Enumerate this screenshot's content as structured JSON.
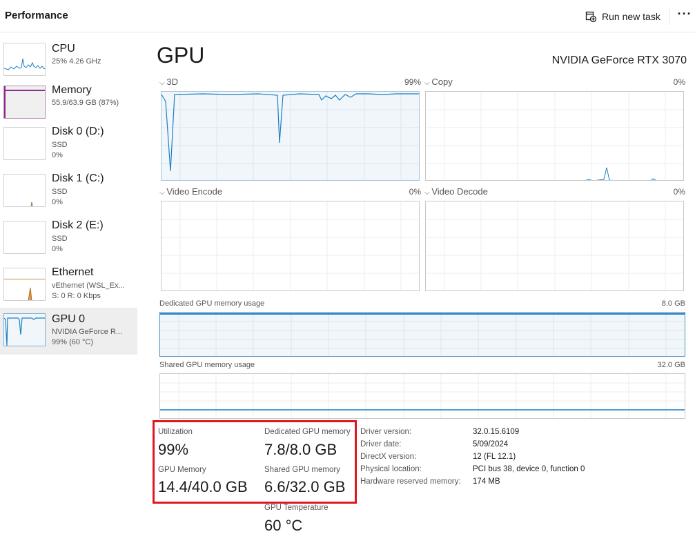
{
  "header": {
    "title": "Performance",
    "run_task_label": "Run new task",
    "more_label": "···"
  },
  "sidebar": {
    "items": [
      {
        "name": "CPU",
        "line1": "25%  4.26 GHz",
        "line2": ""
      },
      {
        "name": "Memory",
        "line1": "55.9/63.9 GB (87%)",
        "line2": ""
      },
      {
        "name": "Disk 0 (D:)",
        "line1": "SSD",
        "line2": "0%"
      },
      {
        "name": "Disk 1 (C:)",
        "line1": "SSD",
        "line2": "0%"
      },
      {
        "name": "Disk 2 (E:)",
        "line1": "SSD",
        "line2": "0%"
      },
      {
        "name": "Ethernet",
        "line1": "vEthernet (WSL_Ex...",
        "line2": "S: 0 R: 0 Kbps"
      },
      {
        "name": "GPU 0",
        "line1": "NVIDIA GeForce R...",
        "line2": "99% (60 °C)"
      }
    ],
    "selected_index": 6
  },
  "main": {
    "title": "GPU",
    "gpu_model": "NVIDIA GeForce RTX 3070",
    "engines": [
      {
        "label": "3D",
        "percent": "99%"
      },
      {
        "label": "Copy",
        "percent": "0%"
      },
      {
        "label": "Video Encode",
        "percent": "0%"
      },
      {
        "label": "Video Decode",
        "percent": "0%"
      }
    ],
    "dedicated_memory": {
      "label": "Dedicated GPU memory usage",
      "max": "8.0 GB"
    },
    "shared_memory": {
      "label": "Shared GPU memory usage",
      "max": "32.0 GB"
    }
  },
  "stats": {
    "utilization": {
      "label": "Utilization",
      "value": "99%"
    },
    "dedicated": {
      "label": "Dedicated GPU memory",
      "value": "7.8/8.0 GB"
    },
    "gpu_memory": {
      "label": "GPU Memory",
      "value": "14.4/40.0 GB"
    },
    "shared": {
      "label": "Shared GPU memory",
      "value": "6.6/32.0 GB"
    },
    "temperature": {
      "label": "GPU Temperature",
      "value": "60 °C"
    }
  },
  "info": [
    {
      "key": "Driver version:",
      "value": "32.0.15.6109"
    },
    {
      "key": "Driver date:",
      "value": "5/09/2024"
    },
    {
      "key": "DirectX version:",
      "value": "12 (FL 12.1)"
    },
    {
      "key": "Physical location:",
      "value": "PCI bus 38, device 0, function 0"
    },
    {
      "key": "Hardware reserved memory:",
      "value": "174 MB"
    }
  ],
  "colors": {
    "gpu_line": "#1b7ec2",
    "memory_accent": "#8b2c8b",
    "ethernet_line": "#b06a1a",
    "highlight_border": "#e0161e"
  }
}
